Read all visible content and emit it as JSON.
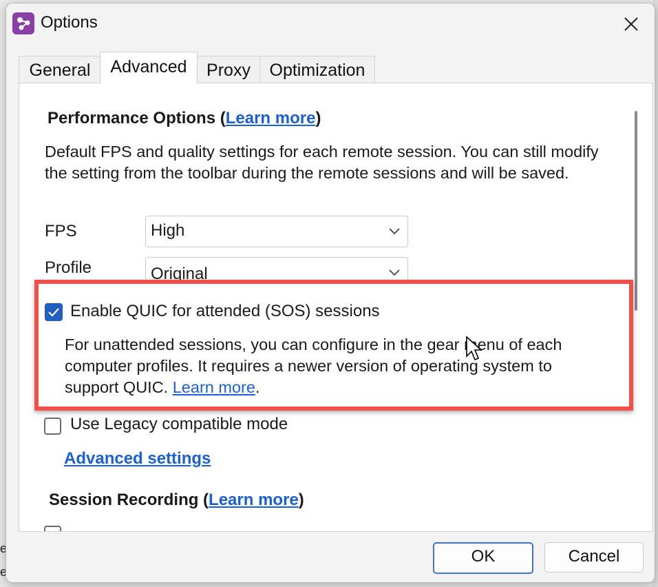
{
  "window": {
    "title": "Options"
  },
  "tabs": [
    "General",
    "Advanced",
    "Proxy",
    "Optimization"
  ],
  "active_tab": "Advanced",
  "performance": {
    "heading": "Performance Options (",
    "heading_link": "Learn more",
    "heading_end": ")",
    "description": "Default FPS and quality settings for each remote session. You can still modify the setting from the toolbar during the remote sessions and will be saved.",
    "fps_label": "FPS",
    "fps_value": "High",
    "profile_label": "Profile",
    "profile_value": "Original"
  },
  "quic": {
    "checked": true,
    "label": "Enable QUIC for attended (SOS) sessions",
    "note": "For unattended sessions, you can configure in the gear menu of each computer profiles. It requires a newer version of operating system to support QUIC. ",
    "note_link": "Learn more",
    "note_end": "."
  },
  "legacy": {
    "checked": false,
    "label": "Use Legacy compatible mode"
  },
  "advanced_settings_link": "Advanced settings",
  "session_recording": {
    "heading": "Session Recording (",
    "heading_link": "Learn more",
    "heading_end": ")"
  },
  "buttons": {
    "ok": "OK",
    "cancel": "Cancel"
  },
  "background_text": [
    "e",
    "e"
  ],
  "colors": {
    "accent": "#1f5fbf",
    "link": "#1a5fd6",
    "highlight": "#f0504a",
    "app_icon": "#8a3fa6"
  }
}
